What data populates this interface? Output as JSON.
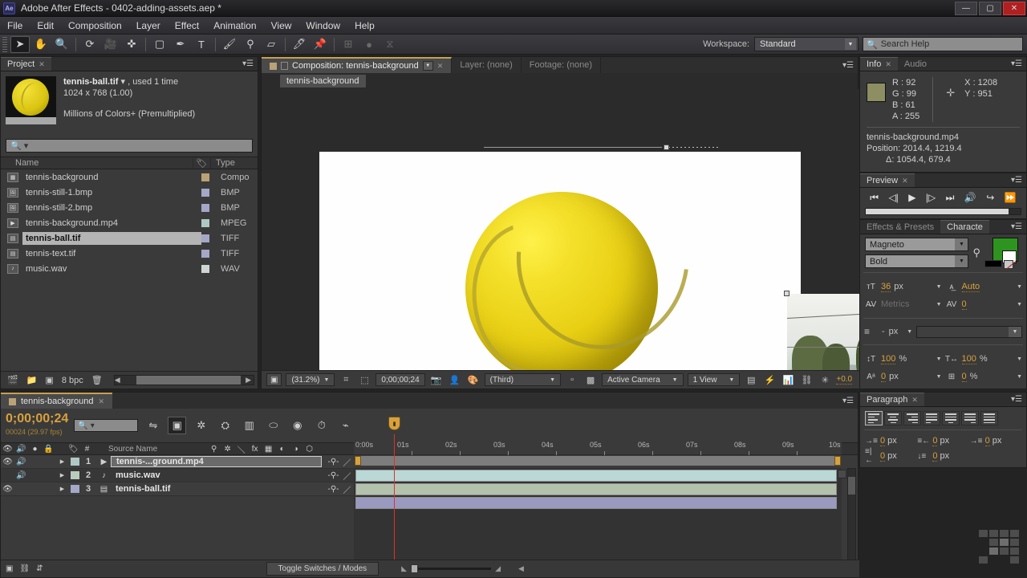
{
  "window": {
    "app_badge": "Ae",
    "title": "Adobe After Effects - 0402-adding-assets.aep *",
    "minimize": "—",
    "maximize": "▢",
    "close": "✕"
  },
  "menu": [
    "File",
    "Edit",
    "Composition",
    "Layer",
    "Effect",
    "Animation",
    "View",
    "Window",
    "Help"
  ],
  "toolbar": {
    "tools": [
      "selection-tool",
      "hand-tool",
      "zoom-tool",
      "rotation-tool",
      "camera-tool",
      "pan-behind-tool",
      "shape-tool",
      "pen-tool",
      "type-tool",
      "brush-tool",
      "clone-stamp-tool",
      "eraser-tool",
      "roto-brush-tool",
      "puppet-pin-tool"
    ],
    "workspace_label": "Workspace:",
    "workspace_value": "Standard",
    "search_placeholder": "Search Help"
  },
  "project": {
    "tab": "Project",
    "selected_file": "tennis-ball.tif",
    "used": ", used 1 time",
    "dimensions": "1024 x 768 (1.00)",
    "color_depth": "Millions of Colors+ (Premultiplied)",
    "search_placeholder": "",
    "columns": {
      "name": "Name",
      "type": "Type"
    },
    "items": [
      {
        "name": "tennis-background",
        "type": "Compo",
        "swatch": "#b9a277",
        "icon": "comp-icon"
      },
      {
        "name": "tennis-still-1.bmp",
        "type": "BMP",
        "swatch": "#a5a7c6",
        "icon": "image-icon"
      },
      {
        "name": "tennis-still-2.bmp",
        "type": "BMP",
        "swatch": "#a5a7c6",
        "icon": "image-icon"
      },
      {
        "name": "tennis-background.mp4",
        "type": "MPEG",
        "swatch": "#aec9c3",
        "icon": "video-icon"
      },
      {
        "name": "tennis-ball.tif",
        "type": "TIFF",
        "swatch": "#a5a7c6",
        "icon": "tiff-icon"
      },
      {
        "name": "tennis-text.tif",
        "type": "TIFF",
        "swatch": "#a5a7c6",
        "icon": "tiff-icon"
      },
      {
        "name": "music.wav",
        "type": "WAV",
        "swatch": "#cfd6d2",
        "icon": "audio-icon"
      }
    ],
    "footer": {
      "bpc": "8 bpc"
    }
  },
  "comp": {
    "tabs": [
      {
        "label": "Composition: tennis-background",
        "active": true
      },
      {
        "label": "Layer: (none)",
        "active": false
      },
      {
        "label": "Footage: (none)",
        "active": false
      }
    ],
    "breadcrumb": "tennis-background",
    "footer": {
      "zoom": "(31.2%)",
      "timecode": "0;00;00;24",
      "resolution": "(Third)",
      "view": "Active Camera",
      "views": "1 View",
      "exposure": "+0.0"
    }
  },
  "info": {
    "tabs": [
      "Info",
      "Audio"
    ],
    "r": "R : 92",
    "g": "G : 99",
    "b": "B : 61",
    "a": "A : 255",
    "x": "X : 1208",
    "y": "Y : 951",
    "layer_name": "tennis-background.mp4",
    "position": "Position: 2014.4, 1219.4",
    "delta": "Δ: 1054.4, 679.4",
    "swatch_color": "#8d8e62"
  },
  "preview": {
    "tab": "Preview",
    "buttons": [
      "first-frame",
      "prev-frame",
      "play",
      "next-frame",
      "last-frame",
      "audio",
      "loop",
      "ram-preview"
    ]
  },
  "character": {
    "tabs": [
      "Effects & Presets",
      "Characte"
    ],
    "font_family": "Magneto",
    "font_style": "Bold",
    "font_size": "36",
    "font_size_unit": "px",
    "leading": "Auto",
    "kerning": "Metrics",
    "tracking": "0",
    "stroke_width": "-",
    "stroke_unit": "px",
    "vertical_scale": "100",
    "horizontal_scale": "100",
    "percent": "%",
    "baseline_shift": "0",
    "baseline_unit": "px",
    "tsume": "0",
    "tsume_unit": "%",
    "fill_color": "#2e9420",
    "stroke_color": "#ffffff"
  },
  "paragraph": {
    "tab": "Paragraph",
    "indent_left": "0",
    "indent_right": "0",
    "indent_first": "0",
    "space_before": "0",
    "space_after": "0",
    "unit": "px"
  },
  "timeline": {
    "tab": "tennis-background",
    "current_time": "0;00;00;24",
    "frame_info": "00024 (29.97 fps)",
    "search_placeholder": "",
    "column_source_name": "Source Name",
    "layers": [
      {
        "index": "1",
        "name": "tennis-...ground.mp4",
        "selected": true,
        "video": true,
        "audio": true,
        "swatch": "#aec9c3",
        "bar_color": "#b9d8d6"
      },
      {
        "index": "2",
        "name": "music.wav",
        "selected": false,
        "video": false,
        "audio": true,
        "swatch": "#b9cbbd",
        "bar_color": "#b3c2ad"
      },
      {
        "index": "3",
        "name": "tennis-ball.tif",
        "selected": false,
        "video": true,
        "audio": false,
        "swatch": "#a5a7c6",
        "bar_color": "#9a9ac0"
      }
    ],
    "time_ticks": [
      "0:00s",
      "01s",
      "02s",
      "03s",
      "04s",
      "05s",
      "06s",
      "07s",
      "08s",
      "09s",
      "10s"
    ],
    "toggle_switches": "Toggle Switches / Modes"
  }
}
